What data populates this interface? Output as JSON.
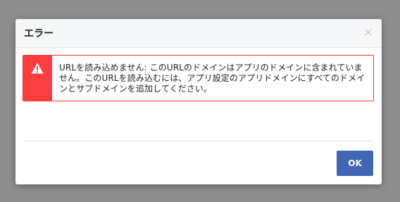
{
  "dialog": {
    "title": "エラー",
    "close_glyph": "×",
    "close_icon": "close-icon"
  },
  "error": {
    "icon": "warning-icon",
    "message": "URLを読み込めません: このURLのドメインはアプリのドメインに含まれていません。このURLを読み込むには、アプリ設定のアプリドメインにすべてのドメインとサブドメインを追加してください。"
  },
  "buttons": {
    "ok_label": "OK"
  },
  "colors": {
    "overlay": "#8e8e8e",
    "error_red": "#fa3e3e",
    "primary_blue": "#4267b2"
  }
}
